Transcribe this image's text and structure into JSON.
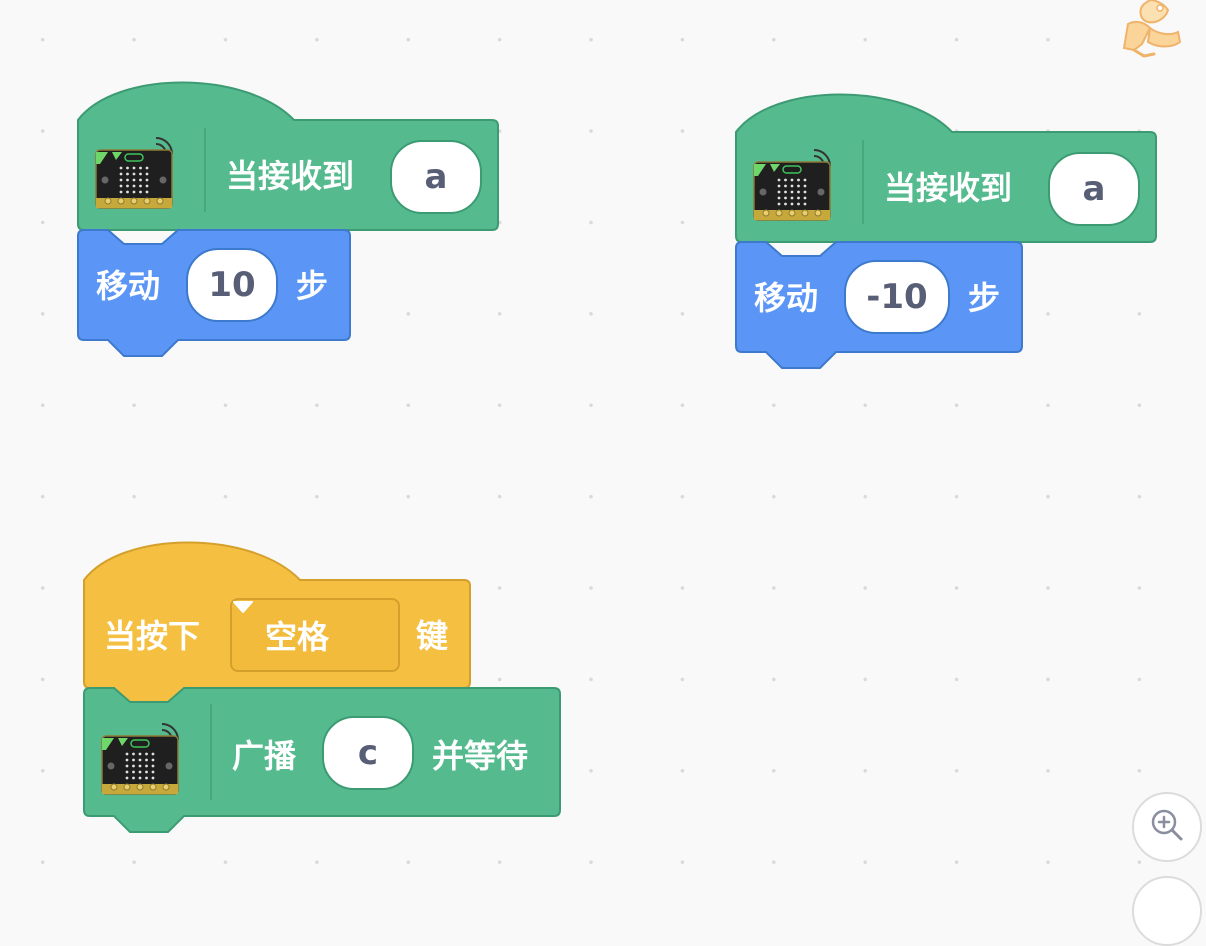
{
  "scripts": [
    {
      "hat": {
        "label": "当接收到",
        "message": "a"
      },
      "action": {
        "label": "移动",
        "value": "10",
        "unit": "步"
      }
    },
    {
      "hat": {
        "label": "当接收到",
        "message": "a"
      },
      "action": {
        "label": "移动",
        "value": "-10",
        "unit": "步"
      }
    },
    {
      "hat": {
        "prefix": "当按下",
        "key": "空格",
        "suffix": "键"
      },
      "action": {
        "label": "广播",
        "message": "c",
        "suffix": "并等待"
      }
    }
  ],
  "colors": {
    "extension_green": "#55bb8f",
    "extension_green_border": "#3d9b74",
    "motion_blue": "#5b96f7",
    "motion_blue_border": "#3d79cc",
    "events_yellow": "#f5c042",
    "events_yellow_border": "#d4a02b",
    "input_text": "#575e75"
  },
  "icons": {
    "extension": "microbit-board-icon",
    "zoom": "zoom-in-icon",
    "sprite": "cat-sprite-icon"
  }
}
